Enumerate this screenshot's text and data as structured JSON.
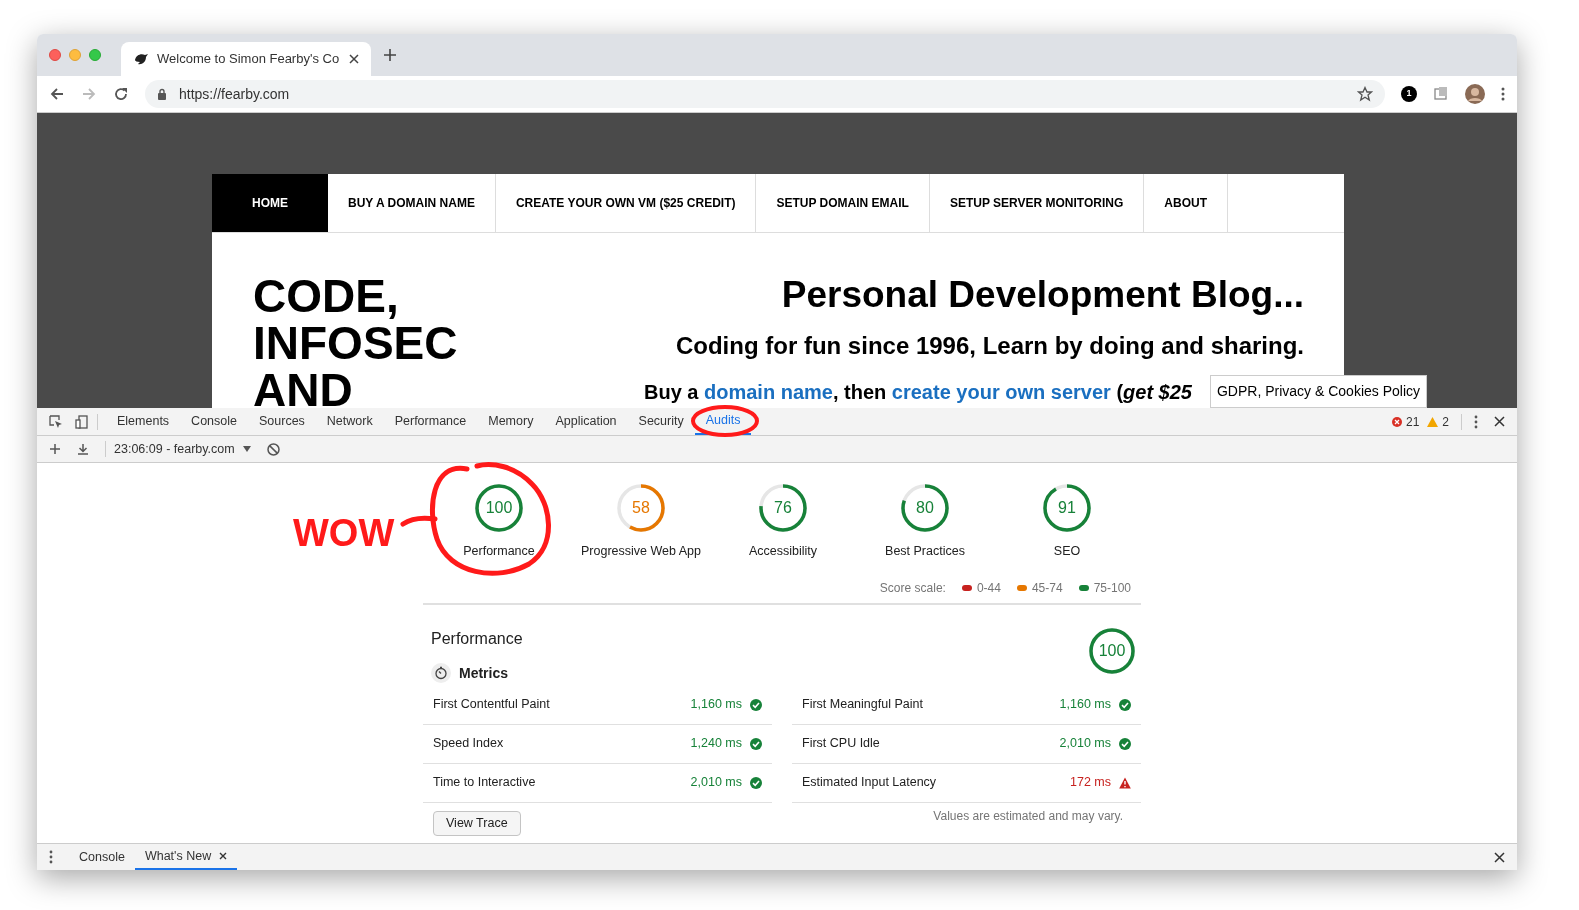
{
  "browser": {
    "tab_title": "Welcome to Simon Fearby's Co",
    "url": "https://fearby.com",
    "extension_badge": "1"
  },
  "website": {
    "nav": [
      {
        "label": "HOME",
        "selected": true
      },
      {
        "label": "BUY A DOMAIN NAME",
        "selected": false
      },
      {
        "label": "CREATE YOUR OWN VM ($25 CREDIT)",
        "selected": false
      },
      {
        "label": "SETUP DOMAIN EMAIL",
        "selected": false
      },
      {
        "label": "SETUP SERVER MONITORING",
        "selected": false
      },
      {
        "label": "ABOUT",
        "selected": false
      }
    ],
    "logo_lines": [
      "CODE,",
      "INFOSEC",
      "AND"
    ],
    "title": "Personal Development Blog...",
    "subtitle": "Coding for fun since 1996, Learn by doing and sharing.",
    "tagline": [
      {
        "kind": "plain",
        "text": "Buy a "
      },
      {
        "kind": "link",
        "text": "domain name"
      },
      {
        "kind": "plain",
        "text": ", then "
      },
      {
        "kind": "link",
        "text": "create your own server"
      },
      {
        "kind": "plain",
        "text": " ("
      },
      {
        "kind": "italic",
        "text": "get $25"
      }
    ],
    "cookie_banner": "GDPR, Privacy & Cookies Policy"
  },
  "devtools": {
    "tabs": [
      {
        "label": "Elements",
        "selected": false
      },
      {
        "label": "Console",
        "selected": false
      },
      {
        "label": "Sources",
        "selected": false
      },
      {
        "label": "Network",
        "selected": false
      },
      {
        "label": "Performance",
        "selected": false
      },
      {
        "label": "Memory",
        "selected": false
      },
      {
        "label": "Application",
        "selected": false
      },
      {
        "label": "Security",
        "selected": false
      },
      {
        "label": "Audits",
        "selected": true
      }
    ],
    "errors": "21",
    "warnings": "2",
    "report": "23:06:09 - fearby.com",
    "gauges": [
      {
        "score": "100",
        "label": "Performance",
        "color": "#178239"
      },
      {
        "score": "58",
        "label": "Progressive Web App",
        "color": "#e67700"
      },
      {
        "score": "76",
        "label": "Accessibility",
        "color": "#178239"
      },
      {
        "score": "80",
        "label": "Best Practices",
        "color": "#178239"
      },
      {
        "score": "91",
        "label": "SEO",
        "color": "#178239"
      }
    ],
    "score_scale": {
      "label": "Score scale:",
      "items": [
        {
          "text": "0-44",
          "color": "#c7221f"
        },
        {
          "text": "45-74",
          "color": "#e67700"
        },
        {
          "text": "75-100",
          "color": "#178239"
        }
      ]
    },
    "section": {
      "title": "Performance",
      "score": "100",
      "color": "#178239",
      "group": "Metrics",
      "metrics": [
        {
          "name": "First Contentful Paint",
          "value": "1,160 ms",
          "kind": "pass"
        },
        {
          "name": "First Meaningful Paint",
          "value": "1,160 ms",
          "kind": "pass"
        },
        {
          "name": "Speed Index",
          "value": "1,240 ms",
          "kind": "pass"
        },
        {
          "name": "First CPU Idle",
          "value": "2,010 ms",
          "kind": "pass"
        },
        {
          "name": "Time to Interactive",
          "value": "2,010 ms",
          "kind": "pass"
        },
        {
          "name": "Estimated Input Latency",
          "value": "172 ms",
          "kind": "fail"
        }
      ],
      "button": "View Trace",
      "note": "Values are estimated and may vary."
    },
    "drawer_tabs": [
      {
        "label": "Console",
        "selected": false,
        "closable": false
      },
      {
        "label": "What's New",
        "selected": true,
        "closable": true
      }
    ]
  },
  "annotations": [
    {
      "text": "WOW"
    }
  ]
}
